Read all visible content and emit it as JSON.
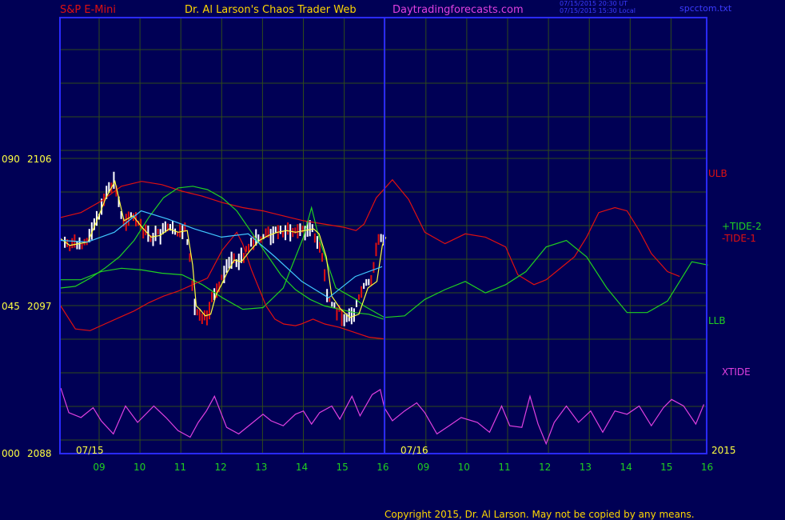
{
  "header": {
    "instrument": "S&P E-Mini",
    "site": "Dr. Al Larson's Chaos Trader Web",
    "url": "Daytradingforecasts.com",
    "stamp_line1": "07/15/2015 20:30 UT",
    "stamp_line2": "07/15/2015 15:30 Local",
    "file": "spcctom.txt"
  },
  "footer": {
    "copyright": "Copyright 2015, Dr. Al Larson. May not be copied by any means."
  },
  "colors": {
    "background": "#000055",
    "frame": "#2a2aff",
    "grid": "#2f4a1a",
    "red": "#e01010",
    "green": "#20d020",
    "magenta": "#e040e0",
    "yellow": "#ffff40",
    "cyan": "#40c8ff",
    "white": "#ffffff"
  },
  "chart_data": {
    "type": "line",
    "left_axis_labels": [
      {
        "text": "090",
        "value": 2106
      },
      {
        "text": "045",
        "value": 2097
      },
      {
        "text": "000",
        "value": 2088
      }
    ],
    "y_tick_labels": [
      "2106",
      "2097",
      "2088"
    ],
    "ylim": [
      2088,
      2106
    ],
    "date_labels": [
      "07/15",
      "07/16"
    ],
    "year_label": "2015",
    "x_tick_labels": [
      "09",
      "10",
      "11",
      "12",
      "13",
      "14",
      "15",
      "16",
      "09",
      "10",
      "11",
      "12",
      "13",
      "14",
      "15",
      "16"
    ],
    "line_labels": [
      "ULB",
      "+TIDE-2",
      "-TIDE-1",
      "LLB",
      "XTIDE"
    ],
    "series": [
      {
        "name": "ULB",
        "color": "#e01010",
        "values": [
          [
            0,
            2102.4
          ],
          [
            0.5,
            2102.7
          ],
          [
            1,
            2103.4
          ],
          [
            1.5,
            2104.3
          ],
          [
            2,
            2104.6
          ],
          [
            2.5,
            2104.4
          ],
          [
            3,
            2104.0
          ],
          [
            3.5,
            2103.7
          ],
          [
            4,
            2103.3
          ],
          [
            4.5,
            2103.0
          ],
          [
            5,
            2102.8
          ],
          [
            5.5,
            2102.5
          ],
          [
            6,
            2102.2
          ],
          [
            6.5,
            2102.0
          ],
          [
            7,
            2101.8
          ],
          [
            7.3,
            2101.6
          ],
          [
            7.5,
            2102.0
          ],
          [
            7.8,
            2103.6
          ],
          [
            8.2,
            2104.7
          ],
          [
            8.6,
            2103.5
          ],
          [
            9,
            2101.5
          ],
          [
            9.5,
            2100.8
          ],
          [
            10,
            2101.4
          ],
          [
            10.5,
            2101.2
          ],
          [
            11,
            2100.6
          ],
          [
            11.3,
            2098.9
          ],
          [
            11.7,
            2098.3
          ],
          [
            12,
            2098.6
          ],
          [
            12.3,
            2099.2
          ],
          [
            12.7,
            2100.0
          ],
          [
            13,
            2101.2
          ],
          [
            13.3,
            2102.7
          ],
          [
            13.7,
            2103.0
          ],
          [
            14,
            2102.8
          ],
          [
            14.3,
            2101.6
          ],
          [
            14.6,
            2100.2
          ],
          [
            15,
            2099.1
          ],
          [
            15.3,
            2098.8
          ]
        ]
      },
      {
        "name": "+TIDE-2",
        "color": "#20d020",
        "values": [
          [
            0,
            2098.6
          ],
          [
            0.5,
            2098.6
          ],
          [
            1,
            2099.1
          ],
          [
            1.5,
            2099.3
          ],
          [
            2,
            2099.2
          ],
          [
            2.5,
            2099.0
          ],
          [
            3,
            2098.9
          ],
          [
            3.5,
            2098.3
          ],
          [
            4,
            2097.5
          ],
          [
            4.5,
            2096.8
          ],
          [
            5,
            2096.9
          ],
          [
            5.5,
            2098.1
          ],
          [
            6,
            2101.2
          ],
          [
            6.2,
            2103.0
          ],
          [
            6.4,
            2101.0
          ],
          [
            6.8,
            2098.1
          ],
          [
            7.3,
            2097.4
          ],
          [
            7.5,
            2097.0
          ],
          [
            8,
            2096.3
          ],
          [
            8.5,
            2096.4
          ],
          [
            9,
            2097.4
          ],
          [
            9.5,
            2098.0
          ],
          [
            10,
            2098.5
          ],
          [
            10.5,
            2097.8
          ],
          [
            11,
            2098.3
          ],
          [
            11.5,
            2099.1
          ],
          [
            12,
            2100.6
          ],
          [
            12.5,
            2101.0
          ],
          [
            13,
            2100.0
          ],
          [
            13.5,
            2098.1
          ],
          [
            14,
            2096.6
          ],
          [
            14.5,
            2096.6
          ],
          [
            15,
            2097.3
          ],
          [
            15.3,
            2098.5
          ],
          [
            15.6,
            2099.7
          ],
          [
            16,
            2099.5
          ]
        ]
      },
      {
        "name": "-TIDE-1",
        "color": "#e01010",
        "values": [
          [
            0,
            2097.0
          ],
          [
            0.5,
            2095.6
          ],
          [
            1,
            2095.5
          ],
          [
            1.5,
            2095.9
          ],
          [
            2,
            2096.3
          ],
          [
            2.5,
            2096.7
          ],
          [
            3,
            2097.2
          ],
          [
            3.5,
            2097.6
          ],
          [
            4,
            2097.9
          ],
          [
            4.5,
            2098.3
          ],
          [
            5,
            2098.7
          ],
          [
            5.5,
            2100.4
          ],
          [
            6,
            2101.5
          ],
          [
            6.2,
            2100.8
          ],
          [
            6.5,
            2099.2
          ],
          [
            7,
            2097.0
          ],
          [
            7.3,
            2096.2
          ],
          [
            7.6,
            2095.9
          ],
          [
            8,
            2095.8
          ],
          [
            8.2,
            2095.9
          ],
          [
            8.6,
            2096.2
          ],
          [
            9,
            2095.9
          ],
          [
            9.5,
            2095.7
          ],
          [
            10,
            2095.4
          ],
          [
            10.5,
            2095.1
          ],
          [
            11,
            2095.0
          ]
        ]
      },
      {
        "name": "LLB",
        "color": "#20d020",
        "values": [
          [
            0,
            2098.1
          ],
          [
            0.5,
            2098.2
          ],
          [
            1,
            2098.7
          ],
          [
            1.5,
            2099.3
          ],
          [
            2,
            2100.0
          ],
          [
            2.5,
            2101.0
          ],
          [
            3,
            2102.4
          ],
          [
            3.5,
            2103.6
          ],
          [
            4,
            2104.2
          ],
          [
            4.5,
            2104.3
          ],
          [
            5,
            2104.1
          ],
          [
            5.5,
            2103.6
          ],
          [
            6,
            2102.8
          ],
          [
            6.5,
            2101.5
          ],
          [
            7,
            2100.2
          ],
          [
            7.5,
            2098.9
          ],
          [
            8,
            2098.0
          ],
          [
            8.5,
            2097.4
          ],
          [
            9,
            2097.0
          ],
          [
            9.5,
            2096.8
          ],
          [
            10,
            2096.6
          ],
          [
            10.5,
            2096.5
          ],
          [
            11,
            2096.2
          ]
        ]
      },
      {
        "name": "XTIDE",
        "color": "#e040e0",
        "values": [
          [
            0,
            2092.0
          ],
          [
            0.2,
            2090.5
          ],
          [
            0.5,
            2090.2
          ],
          [
            0.8,
            2090.8
          ],
          [
            1,
            2090.0
          ],
          [
            1.3,
            2089.2
          ],
          [
            1.6,
            2090.9
          ],
          [
            1.9,
            2089.9
          ],
          [
            2.3,
            2090.9
          ],
          [
            2.6,
            2090.2
          ],
          [
            2.9,
            2089.4
          ],
          [
            3.2,
            2089.0
          ],
          [
            3.4,
            2089.9
          ],
          [
            3.6,
            2090.6
          ],
          [
            3.8,
            2091.5
          ],
          [
            4.1,
            2089.6
          ],
          [
            4.4,
            2089.2
          ],
          [
            4.7,
            2089.8
          ],
          [
            5,
            2090.4
          ],
          [
            5.2,
            2090.0
          ],
          [
            5.5,
            2089.7
          ],
          [
            5.8,
            2090.4
          ],
          [
            6,
            2090.6
          ],
          [
            6.2,
            2089.8
          ],
          [
            6.4,
            2090.5
          ],
          [
            6.7,
            2090.9
          ],
          [
            6.9,
            2090.1
          ],
          [
            7.2,
            2091.5
          ],
          [
            7.4,
            2090.3
          ],
          [
            7.7,
            2091.6
          ],
          [
            7.9,
            2091.9
          ],
          [
            8,
            2090.8
          ],
          [
            8.2,
            2090.0
          ],
          [
            8.5,
            2090.6
          ],
          [
            8.8,
            2091.1
          ],
          [
            9,
            2090.5
          ],
          [
            9.3,
            2089.2
          ],
          [
            9.6,
            2089.7
          ],
          [
            9.9,
            2090.2
          ],
          [
            10.3,
            2089.9
          ],
          [
            10.6,
            2089.3
          ],
          [
            10.9,
            2090.9
          ],
          [
            11.1,
            2089.7
          ],
          [
            11.4,
            2089.6
          ],
          [
            11.6,
            2091.5
          ],
          [
            11.8,
            2089.8
          ],
          [
            12,
            2088.6
          ],
          [
            12.2,
            2089.9
          ],
          [
            12.5,
            2090.9
          ],
          [
            12.8,
            2089.9
          ],
          [
            13.1,
            2090.6
          ],
          [
            13.4,
            2089.3
          ],
          [
            13.7,
            2090.6
          ],
          [
            14,
            2090.4
          ],
          [
            14.3,
            2090.9
          ],
          [
            14.6,
            2089.7
          ],
          [
            14.9,
            2090.8
          ],
          [
            15.1,
            2091.3
          ],
          [
            15.4,
            2090.9
          ],
          [
            15.7,
            2089.8
          ],
          [
            15.9,
            2091.0
          ]
        ]
      },
      {
        "name": "",
        "color": "#ffff40",
        "values": [
          [
            0,
            2101.1
          ],
          [
            0.5,
            2100.7
          ],
          [
            1,
            2100.8
          ],
          [
            1.5,
            2100.9
          ],
          [
            2,
            2102.2
          ],
          [
            2.5,
            2103.6
          ],
          [
            3,
            2104.6
          ],
          [
            3.5,
            2102.2
          ],
          [
            4,
            2102.5
          ],
          [
            4.5,
            2101.8
          ],
          [
            5,
            2101.2
          ],
          [
            5.5,
            2101.3
          ],
          [
            6,
            2101.7
          ],
          [
            6.5,
            2101.5
          ],
          [
            7,
            2101.6
          ],
          [
            7.3,
            2099.5
          ],
          [
            7.5,
            2097.0
          ],
          [
            7.7,
            2096.8
          ],
          [
            8,
            2096.4
          ],
          [
            8.3,
            2096.5
          ],
          [
            8.6,
            2097.7
          ],
          [
            8.9,
            2098.3
          ],
          [
            9.2,
            2099.0
          ],
          [
            9.6,
            2099.8
          ],
          [
            10,
            2099.7
          ],
          [
            10.5,
            2100.4
          ],
          [
            11,
            2101.0
          ],
          [
            11.5,
            2101.3
          ],
          [
            12,
            2101.5
          ],
          [
            12.5,
            2101.6
          ],
          [
            13,
            2101.5
          ],
          [
            13.5,
            2101.6
          ],
          [
            14,
            2101.7
          ],
          [
            14.3,
            2101.4
          ],
          [
            14.7,
            2100.0
          ],
          [
            15,
            2097.6
          ],
          [
            15.5,
            2096.8
          ],
          [
            16,
            2096.3
          ],
          [
            16.5,
            2096.5
          ],
          [
            17,
            2098.1
          ],
          [
            17.5,
            2098.5
          ],
          [
            17.8,
            2100.7
          ],
          [
            18,
            2101.2
          ]
        ]
      },
      {
        "name": "",
        "color": "#40c8ff",
        "values": [
          [
            0,
            2101.0
          ],
          [
            1,
            2100.9
          ],
          [
            2,
            2101.5
          ],
          [
            3,
            2102.8
          ],
          [
            4,
            2102.3
          ],
          [
            5,
            2101.7
          ],
          [
            6,
            2101.2
          ],
          [
            7,
            2101.4
          ],
          [
            8,
            2100.0
          ],
          [
            9,
            2098.5
          ],
          [
            10,
            2097.5
          ],
          [
            11,
            2098.8
          ],
          [
            12,
            2099.4
          ]
        ]
      }
    ]
  }
}
